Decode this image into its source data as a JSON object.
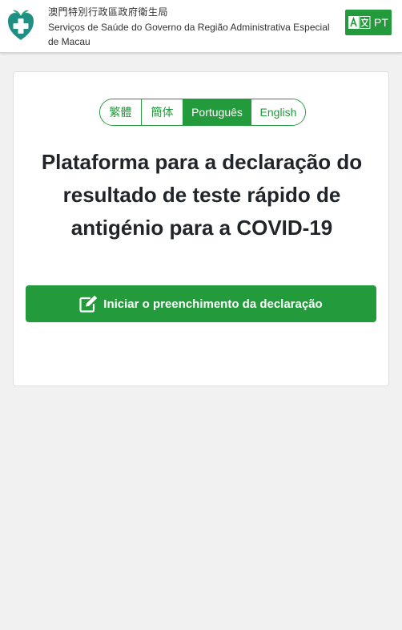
{
  "header": {
    "org_name_zh": "澳門特別行政區政府衛生局",
    "org_name_pt": "Serviços de Saúde do Governo da Região Administrativa Especial de Macau",
    "language_button": {
      "label": "PT",
      "icon": "translate-icon"
    }
  },
  "main": {
    "languages": [
      {
        "label": "繁體",
        "active": false
      },
      {
        "label": "簡体",
        "active": false
      },
      {
        "label": "Português",
        "active": true
      },
      {
        "label": "English",
        "active": false
      }
    ],
    "title": "Plataforma para a declaração do resultado de teste rápido de antigénio para a COVID-19",
    "start_button": {
      "label": "Iniciar o preenchimento da declaração",
      "icon": "edit-icon"
    }
  },
  "colors": {
    "accent": "#239a3b",
    "background": "#f1f1f1",
    "card": "#ffffff"
  }
}
